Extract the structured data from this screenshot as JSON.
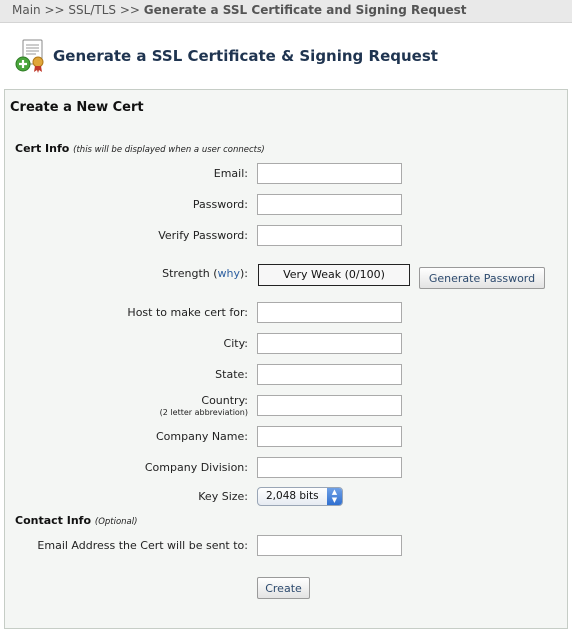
{
  "breadcrumb": {
    "items": [
      "Main",
      "SSL/TLS"
    ],
    "separator": ">>",
    "current": "Generate a SSL Certificate and Signing Request"
  },
  "header": {
    "title": "Generate a SSL Certificate & Signing Request",
    "icon": "certificate-add-icon"
  },
  "form": {
    "section_title": "Create a New Cert",
    "cert_info": {
      "title": "Cert Info",
      "note": "(this will be displayed when a user connects)"
    },
    "labels": {
      "email": "Email:",
      "password": "Password:",
      "verify_password": "Verify Password:",
      "strength_prefix": "Strength (",
      "strength_link": "why",
      "strength_suffix": "):",
      "host": "Host to make cert for:",
      "city": "City:",
      "state": "State:",
      "country": "Country:",
      "country_hint": "(2 letter abbreviation)",
      "company_name": "Company Name:",
      "company_division": "Company Division:",
      "key_size": "Key Size:",
      "contact_email": "Email Address the Cert will be sent to:"
    },
    "values": {
      "email": "",
      "password": "",
      "verify_password": "",
      "host": "",
      "city": "",
      "state": "",
      "country": "",
      "company_name": "",
      "company_division": "",
      "contact_email": ""
    },
    "strength_meter": "Very Weak (0/100)",
    "generate_password_label": "Generate Password",
    "key_size_selected": "2,048 bits",
    "contact_info": {
      "title": "Contact Info",
      "note": "(Optional)"
    },
    "create_label": "Create"
  },
  "colors": {
    "title": "#1f3450",
    "panel_background": "#f4f6f4",
    "link": "#2d5fa0",
    "select_accent": "#2f6fd0"
  }
}
